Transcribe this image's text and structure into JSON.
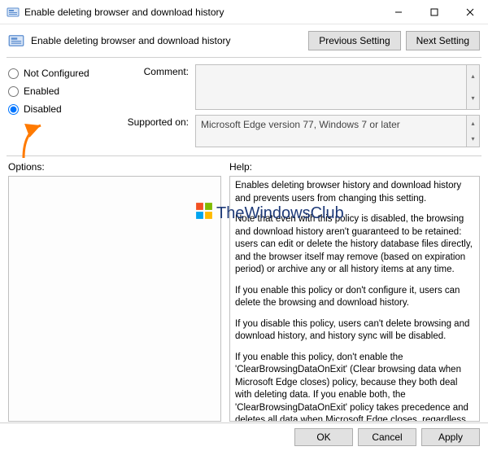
{
  "window": {
    "title": "Enable deleting browser and download history",
    "minimize": "Minimize",
    "maximize": "Maximize",
    "close": "Close"
  },
  "header": {
    "title": "Enable deleting browser and download history"
  },
  "nav": {
    "previous": "Previous Setting",
    "next": "Next Setting"
  },
  "radios": {
    "not_configured": "Not Configured",
    "enabled": "Enabled",
    "disabled": "Disabled",
    "selected": "disabled"
  },
  "fields": {
    "comment_label": "Comment:",
    "comment_value": "",
    "supported_label": "Supported on:",
    "supported_value": "Microsoft Edge version 77, Windows 7 or later"
  },
  "sections": {
    "options_label": "Options:",
    "help_label": "Help:"
  },
  "help_paragraphs": [
    "Enables deleting browser history and download history and prevents users from changing this setting.",
    "Note that even with this policy is disabled, the browsing and download history aren't guaranteed to be retained: users can edit or delete the history database files directly, and the browser itself may remove (based on expiration period) or archive any or all history items at any time.",
    "If you enable this policy or don't configure it, users can delete the browsing and download history.",
    "If you disable this policy, users can't delete browsing and download history, and history sync will be disabled.",
    "If you enable this policy, don't enable the 'ClearBrowsingDataOnExit' (Clear browsing data when Microsoft Edge closes) policy, because they both deal with deleting data. If you enable both, the 'ClearBrowsingDataOnExit' policy takes precedence and deletes all data when Microsoft Edge closes, regardless of how this policy is configured."
  ],
  "footer": {
    "ok": "OK",
    "cancel": "Cancel",
    "apply": "Apply"
  },
  "watermark": {
    "text": "TheWindowsClub"
  }
}
